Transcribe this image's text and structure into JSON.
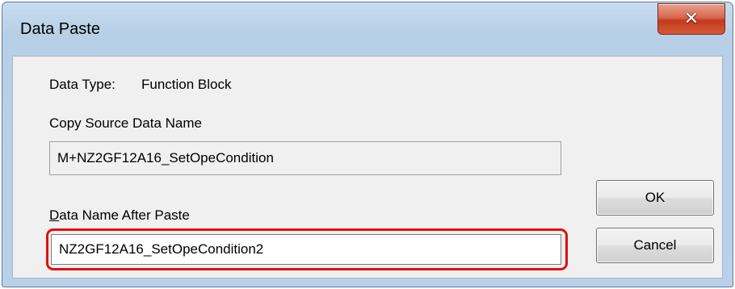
{
  "window": {
    "title": "Data Paste",
    "close_glyph": "✕"
  },
  "form": {
    "data_type_label": "Data Type:",
    "data_type_value": "Function Block",
    "copy_source_label": "Copy Source Data Name",
    "copy_source_value": "M+NZ2GF12A16_SetOpeCondition",
    "after_paste_label_underlined": "D",
    "after_paste_label_rest": "ata Name After Paste",
    "after_paste_value": "NZ2GF12A16_SetOpeCondition2"
  },
  "buttons": {
    "ok_label": "OK",
    "cancel_label": "Cancel"
  },
  "colors": {
    "highlight": "#e01010",
    "close_button": "#c4391e"
  }
}
